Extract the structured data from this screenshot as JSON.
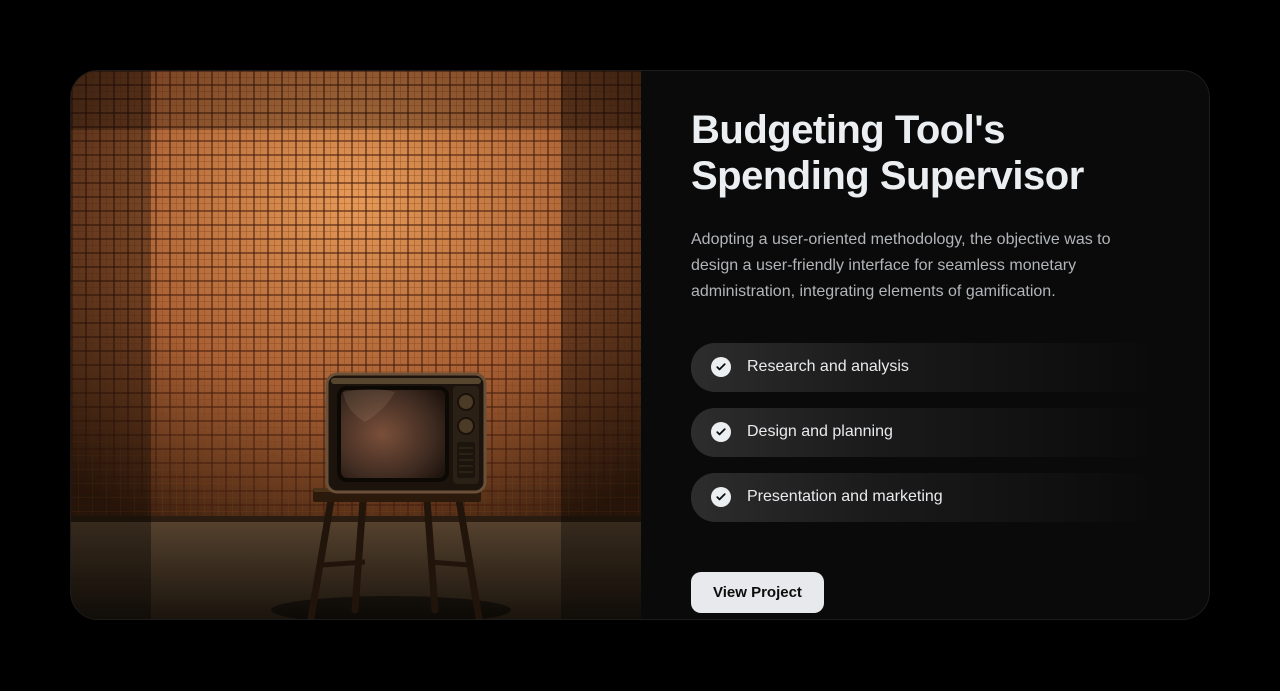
{
  "project": {
    "title": "Budgeting Tool's Spending Supervisor",
    "description": "Adopting a user-oriented methodology, the objective was to design a user-friendly interface for seamless monetary administration, integrating elements of gamification.",
    "features": [
      {
        "label": "Research and analysis"
      },
      {
        "label": "Design and planning"
      },
      {
        "label": "Presentation and marketing"
      }
    ],
    "cta_label": "View Project"
  }
}
